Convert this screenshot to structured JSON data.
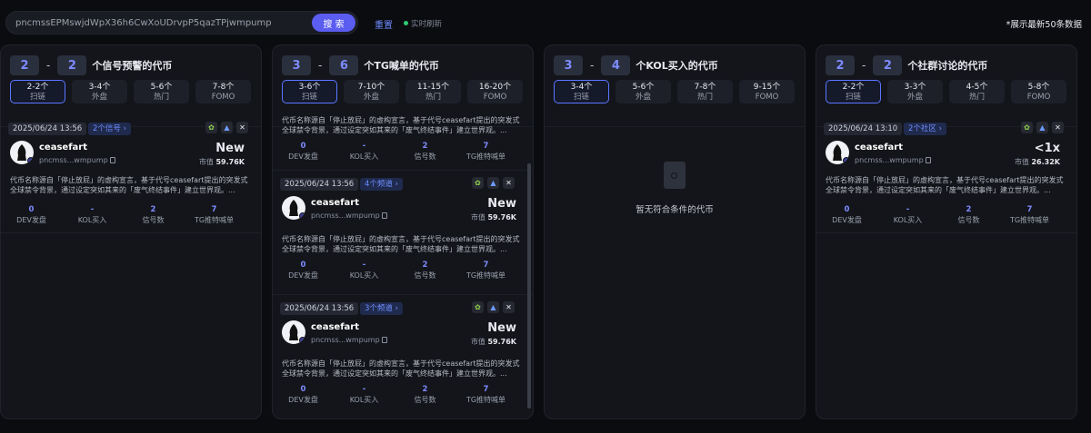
{
  "search": {
    "value": "pncmssEPMswjdWpX36h6CwXoUDrvpP5qazTPjwmpump",
    "button": "搜 索"
  },
  "reset": "重置",
  "live": "实时刷新",
  "note": "*展示最新50条数据",
  "columns": [
    {
      "from": "2",
      "to": "2",
      "title": "个信号预警的代币",
      "tabs": [
        {
          "t1": "2-2个",
          "t2": "扫链"
        },
        {
          "t1": "3-4个",
          "t2": "外盘"
        },
        {
          "t1": "5-6个",
          "t2": "热门"
        },
        {
          "t1": "7-8个",
          "t2": "FOMO"
        }
      ],
      "cards": [
        {
          "date": "2025/06/24 13:56",
          "chip": "2个信号 ›",
          "name": "ceasefart",
          "addr": "pncmss...wmpump",
          "status": "New",
          "mcap_label": "市值",
          "mcap": "59.76K",
          "desc": "代币名称源自「停止放屁」的虚构宣言，基于代号ceasefart提出的突发式全球禁令背景，通过设定突如其来的「废气终结事件」建立世界观。...",
          "stats": [
            {
              "v": "0",
              "l": "DEV发盘"
            },
            {
              "v": "-",
              "l": "KOL买入"
            },
            {
              "v": "2",
              "l": "信号数"
            },
            {
              "v": "7",
              "l": "TG推特喊单"
            }
          ]
        }
      ]
    },
    {
      "from": "3",
      "to": "6",
      "title": "个TG喊单的代币",
      "tabs": [
        {
          "t1": "3-6个",
          "t2": "扫链"
        },
        {
          "t1": "7-10个",
          "t2": "外盘"
        },
        {
          "t1": "11-15个",
          "t2": "热门"
        },
        {
          "t1": "16-20个",
          "t2": "FOMO"
        }
      ],
      "partial": {
        "desc": "代币名称源自「停止放屁」的虚构宣言，基于代号ceasefart提出的突发式全球禁令背景，通过设定突如其来的「废气终结事件」建立世界观。...",
        "stats": [
          {
            "v": "0",
            "l": "DEV发盘"
          },
          {
            "v": "-",
            "l": "KOL买入"
          },
          {
            "v": "2",
            "l": "信号数"
          },
          {
            "v": "7",
            "l": "TG推特喊单"
          }
        ]
      },
      "cards": [
        {
          "date": "2025/06/24 13:56",
          "chip": "4个频道 ›",
          "name": "ceasefart",
          "addr": "pncmss...wmpump",
          "status": "New",
          "mcap_label": "市值",
          "mcap": "59.76K",
          "desc": "代币名称源自「停止放屁」的虚构宣言，基于代号ceasefart提出的突发式全球禁令背景，通过设定突如其来的「废气终结事件」建立世界观。...",
          "stats": [
            {
              "v": "0",
              "l": "DEV发盘"
            },
            {
              "v": "-",
              "l": "KOL买入"
            },
            {
              "v": "2",
              "l": "信号数"
            },
            {
              "v": "7",
              "l": "TG推特喊单"
            }
          ]
        },
        {
          "date": "2025/06/24 13:56",
          "chip": "3个频道 ›",
          "name": "ceasefart",
          "addr": "pncmss...wmpump",
          "status": "New",
          "mcap_label": "市值",
          "mcap": "59.76K",
          "desc": "代币名称源自「停止放屁」的虚构宣言，基于代号ceasefart提出的突发式全球禁令背景，通过设定突如其来的「废气终结事件」建立世界观。...",
          "stats": [
            {
              "v": "0",
              "l": "DEV发盘"
            },
            {
              "v": "-",
              "l": "KOL买入"
            },
            {
              "v": "2",
              "l": "信号数"
            },
            {
              "v": "7",
              "l": "TG推特喊单"
            }
          ]
        }
      ]
    },
    {
      "from": "3",
      "to": "4",
      "title": "个KOL买入的代币",
      "tabs": [
        {
          "t1": "3-4个",
          "t2": "扫链"
        },
        {
          "t1": "5-6个",
          "t2": "外盘"
        },
        {
          "t1": "7-8个",
          "t2": "热门"
        },
        {
          "t1": "9-15个",
          "t2": "FOMO"
        }
      ],
      "empty": "暂无符合条件的代币"
    },
    {
      "from": "2",
      "to": "2",
      "title": "个社群讨论的代币",
      "tabs": [
        {
          "t1": "2-2个",
          "t2": "扫链"
        },
        {
          "t1": "3-3个",
          "t2": "外盘"
        },
        {
          "t1": "4-5个",
          "t2": "热门"
        },
        {
          "t1": "5-8个",
          "t2": "FOMO"
        }
      ],
      "cards": [
        {
          "date": "2025/06/24 13:10",
          "chip": "2个社区 ›",
          "name": "ceasefart",
          "addr": "pncmss...wmpump",
          "status": "<1x",
          "mcap_label": "市值",
          "mcap": "26.32K",
          "desc": "代币名称源自「停止放屁」的虚构宣言，基于代号ceasefart提出的突发式全球禁令背景，通过设定突如其来的「废气终结事件」建立世界观。...",
          "stats": [
            {
              "v": "0",
              "l": "DEV发盘"
            },
            {
              "v": "-",
              "l": "KOL买入"
            },
            {
              "v": "2",
              "l": "信号数"
            },
            {
              "v": "7",
              "l": "TG推特喊单"
            }
          ]
        }
      ]
    }
  ]
}
